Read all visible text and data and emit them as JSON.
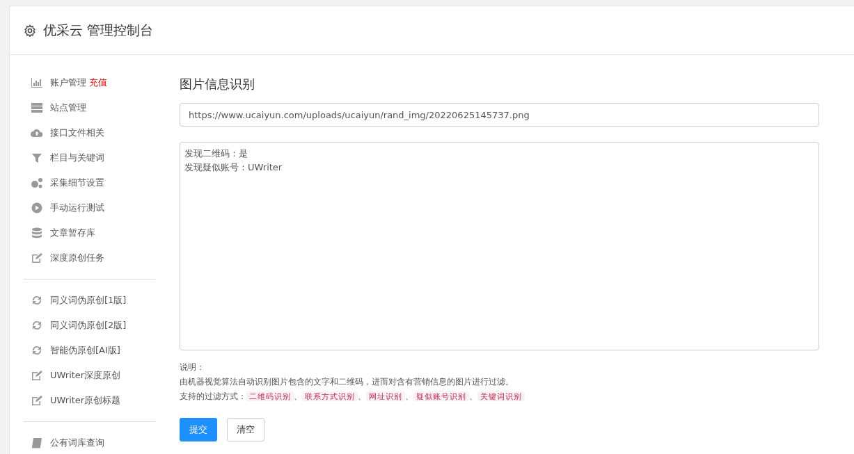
{
  "header": {
    "title": "优采云 管理控制台"
  },
  "sidebar": {
    "groups": [
      {
        "items": [
          {
            "label": "账户管理",
            "badge": "充值"
          },
          {
            "label": "站点管理"
          },
          {
            "label": "接口文件相关"
          },
          {
            "label": "栏目与关键词"
          },
          {
            "label": "采集细节设置"
          },
          {
            "label": "手动运行测试"
          },
          {
            "label": "文章暂存库"
          },
          {
            "label": "深度原创任务"
          }
        ]
      },
      {
        "items": [
          {
            "label": "同义词伪原创[1版]"
          },
          {
            "label": "同义词伪原创[2版]"
          },
          {
            "label": "智能伪原创[AI版]"
          },
          {
            "label": "UWriter深度原创"
          },
          {
            "label": "UWriter原创标题"
          }
        ]
      },
      {
        "items": [
          {
            "label": "公有词库查询"
          }
        ]
      }
    ]
  },
  "main": {
    "title": "图片信息识别",
    "url_field": {
      "value": "https://www.ucaiyun.com/uploads/ucaiyun/rand_img/20220625145737.png"
    },
    "result_box": {
      "lines": [
        "发现二维码：是",
        "发现疑似账号：UWriter"
      ]
    },
    "notes": {
      "heading": "说明：",
      "description": "由机器视觉算法自动识别图片包含的文字和二维码，进而对含有营销信息的图片进行过滤。",
      "filters_label": "支持的过滤方式：",
      "separator": "、",
      "filters": [
        "二维码识别",
        "联系方式识别",
        "网址识别",
        "疑似账号识别",
        "关键词识别"
      ]
    },
    "buttons": [
      {
        "label": "提交",
        "kind": "primary"
      },
      {
        "label": "清空",
        "kind": "secondary"
      }
    ]
  }
}
